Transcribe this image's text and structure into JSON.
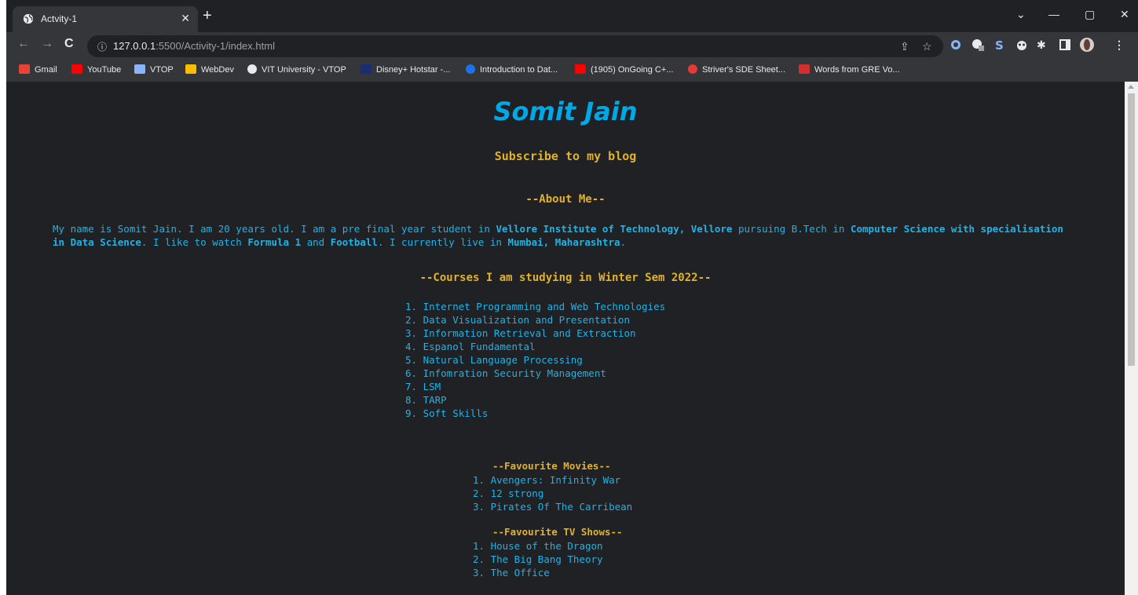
{
  "browser": {
    "tab_title": "Actvity-1",
    "url_host": "127.0.0.1",
    "url_rest": ":5500/Activity-1/index.html",
    "bookmarks": [
      {
        "label": "Gmail",
        "color": "#ea4335"
      },
      {
        "label": "YouTube",
        "color": "#ff0000"
      },
      {
        "label": "VTOP",
        "color": "#8ab4f8"
      },
      {
        "label": "WebDev",
        "color": "#fbbc04"
      },
      {
        "label": "VIT University - VTOP",
        "color": "#e8eaed"
      },
      {
        "label": "Disney+ Hotstar -...",
        "color": "#1a2c74"
      },
      {
        "label": "Introduction to Dat...",
        "color": "#1a73e8"
      },
      {
        "label": "(1905) OnGoing C+...",
        "color": "#ff0000"
      },
      {
        "label": "Striver's SDE Sheet...",
        "color": "#e53935"
      },
      {
        "label": "Words from GRE Vo...",
        "color": "#d32f2f"
      }
    ]
  },
  "page": {
    "name": "Somit Jain",
    "subscribe": "Subscribe to my blog",
    "about_heading": "--About Me--",
    "about": {
      "t1": "My name is Somit Jain. I am 20 years old. I am a pre final year student in ",
      "b1": "Vellore Institute of Technology, Vellore",
      "t2": " pursuing B.Tech in ",
      "b2": "Computer Science with specialisation in Data Science",
      "t3": ". I like to watch ",
      "b3": "Formula 1",
      "t4": " and ",
      "b4": "Football",
      "t5": ". I currently live in ",
      "b5": "Mumbai, Maharashtra",
      "t6": "."
    },
    "courses_heading": "--Courses I am studying in Winter Sem 2022--",
    "courses": [
      "1. Internet Programming and Web Technologies",
      "2. Data Visualization and Presentation",
      "3. Information Retrieval and Extraction",
      "4. Espanol Fundamental",
      "5. Natural Language Processing",
      "6. Infomration Security Management",
      "7. LSM",
      "8. TARP",
      "9. Soft Skills"
    ],
    "movies_heading": "--Favourite Movies--",
    "movies": [
      "1. Avengers: Infinity War",
      "2. 12 strong",
      "3. Pirates Of The Carribean"
    ],
    "tv_heading": "--Favourite TV Shows--",
    "tv": [
      "1. House of the Dragon",
      "2. The Big Bang Theory",
      "3. The Office"
    ]
  }
}
